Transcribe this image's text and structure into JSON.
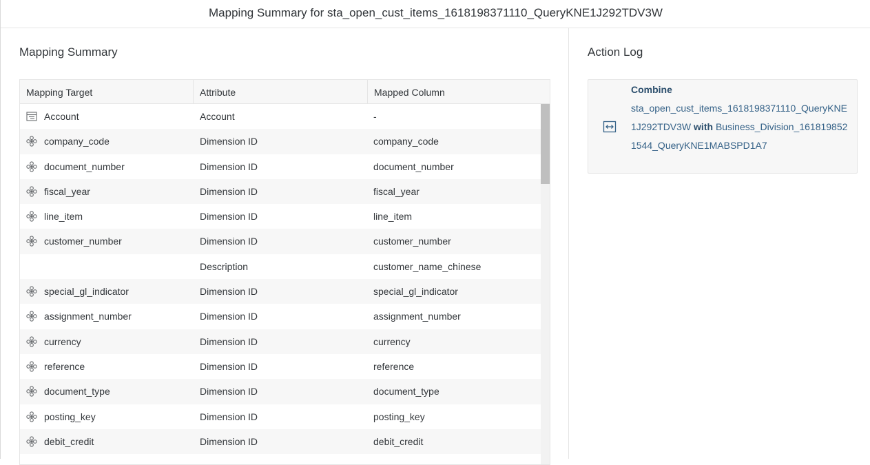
{
  "dialog": {
    "title": "Mapping Summary for sta_open_cust_items_1618198371110_QueryKNE1J292TDV3W"
  },
  "mapping_summary": {
    "title": "Mapping Summary",
    "columns": [
      "Mapping Target",
      "Attribute",
      "Mapped Column"
    ],
    "rows": [
      {
        "target": "Account",
        "icon": "account-hierarchy-icon",
        "attribute": "Account",
        "mapped": "-"
      },
      {
        "target": "company_code",
        "icon": "dimension-icon",
        "attribute": "Dimension ID",
        "mapped": "company_code"
      },
      {
        "target": "document_number",
        "icon": "dimension-icon",
        "attribute": "Dimension ID",
        "mapped": "document_number"
      },
      {
        "target": "fiscal_year",
        "icon": "dimension-icon",
        "attribute": "Dimension ID",
        "mapped": "fiscal_year"
      },
      {
        "target": "line_item",
        "icon": "dimension-icon",
        "attribute": "Dimension ID",
        "mapped": "line_item"
      },
      {
        "target": "customer_number",
        "icon": "dimension-icon",
        "attribute": "Dimension ID",
        "mapped": "customer_number"
      },
      {
        "target": "",
        "icon": "",
        "attribute": "Description",
        "mapped": "customer_name_chinese"
      },
      {
        "target": "special_gl_indicator",
        "icon": "dimension-icon",
        "attribute": "Dimension ID",
        "mapped": "special_gl_indicator"
      },
      {
        "target": "assignment_number",
        "icon": "dimension-icon",
        "attribute": "Dimension ID",
        "mapped": "assignment_number"
      },
      {
        "target": "currency",
        "icon": "dimension-icon",
        "attribute": "Dimension ID",
        "mapped": "currency"
      },
      {
        "target": "reference",
        "icon": "dimension-icon",
        "attribute": "Dimension ID",
        "mapped": "reference"
      },
      {
        "target": "document_type",
        "icon": "dimension-icon",
        "attribute": "Dimension ID",
        "mapped": "document_type"
      },
      {
        "target": "posting_key",
        "icon": "dimension-icon",
        "attribute": "Dimension ID",
        "mapped": "posting_key"
      },
      {
        "target": "debit_credit",
        "icon": "dimension-icon",
        "attribute": "Dimension ID",
        "mapped": "debit_credit"
      }
    ]
  },
  "action_log": {
    "title": "Action Log",
    "entry": {
      "icon": "combine-icon",
      "action": "Combine",
      "source": "sta_open_cust_items_1618198371110_QueryKNE1J292TDV3W",
      "connector": "with",
      "target": "Business_Division_1618198521544_QueryKNE1MABSPD1A7"
    }
  },
  "colors": {
    "link": "#346187",
    "text": "#32363a",
    "row_alt": "#f7f7f7",
    "border": "#e5e5e5"
  }
}
